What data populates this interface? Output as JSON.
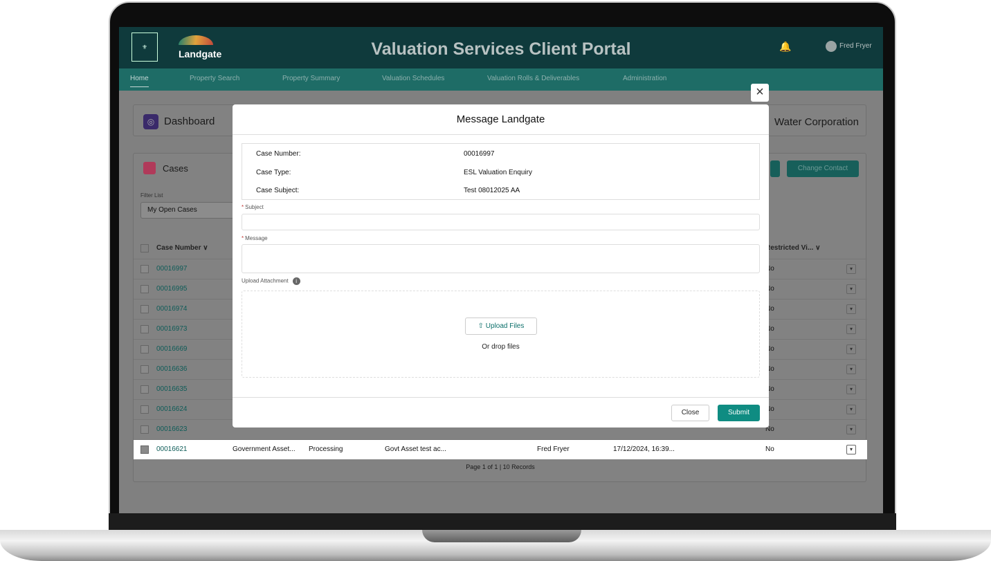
{
  "header": {
    "brand": "Landgate",
    "title": "Valuation Services Client Portal",
    "user": "Fred Fryer"
  },
  "nav": [
    "Home",
    "Property Search",
    "Property Summary",
    "Valuation Schedules",
    "Valuation Rolls & Deliverables",
    "Administration"
  ],
  "dashboard": {
    "title": "Dashboard",
    "organisation": "Water Corporation"
  },
  "cases": {
    "title": "Cases",
    "filter_label": "Filter List",
    "filter_value": "My Open Cases",
    "change_contact": "Change Contact",
    "col_case_number": "Case Number",
    "col_restricted": "Restricted Vi...",
    "rows": [
      "00016997",
      "00016995",
      "00016974",
      "00016973",
      "00016669",
      "00016636",
      "00016635",
      "00016624",
      "00016623",
      "00016621"
    ],
    "row_value": "No",
    "last_row": {
      "type": "Government Asset...",
      "status": "Processing",
      "subject": "Govt Asset test ac...",
      "contact": "Fred Fryer",
      "date": "17/12/2024, 16:39..."
    },
    "pager": "Page 1 of 1 | 10 Records"
  },
  "modal": {
    "title": "Message Landgate",
    "close_x": "×",
    "info": [
      {
        "label": "Case Number:",
        "value": "00016997"
      },
      {
        "label": "Case Type:",
        "value": "ESL Valuation Enquiry"
      },
      {
        "label": "Case Subject:",
        "value": "Test 08012025 AA"
      }
    ],
    "subject_label": "Subject",
    "message_label": "Message",
    "upload_label": "Upload Attachment",
    "upload_button": "Upload Files",
    "drop_text": "Or drop files",
    "close_button": "Close",
    "submit_button": "Submit"
  },
  "colors": {
    "brand_teal": "#0f8c82",
    "header": "#0f3a3c",
    "nav": "#1e6c66"
  }
}
